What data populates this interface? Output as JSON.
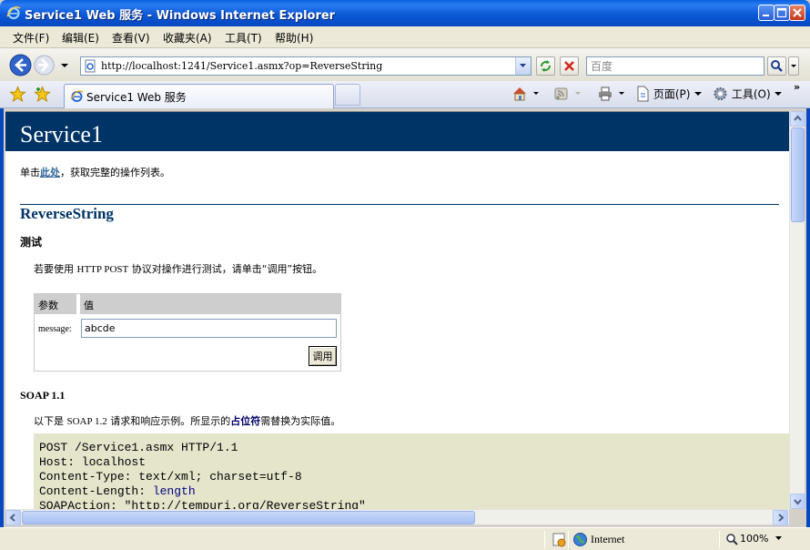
{
  "window": {
    "title": "Service1 Web 服务 - Windows Internet Explorer"
  },
  "menu": [
    "文件(F)",
    "编辑(E)",
    "查看(V)",
    "收藏夹(A)",
    "工具(T)",
    "帮助(H)"
  ],
  "address": {
    "url": "http://localhost:1241/Service1.asmx?op=ReverseString"
  },
  "search": {
    "placeholder": "百度"
  },
  "tab": {
    "label": "Service1 Web 服务"
  },
  "commands": {
    "page": "页面(P)",
    "tools": "工具(O)",
    "more": "»"
  },
  "page": {
    "title": "Service1",
    "intro_prefix": "单击",
    "intro_link": "此处",
    "intro_suffix": "，获取完整的操作列表。",
    "operation": "ReverseString",
    "test_heading": "测试",
    "test_desc_1": "若要使用 ",
    "test_desc_mono": "HTTP POST",
    "test_desc_2": " 协议对操作进行测试，请单击“调用”按钮。",
    "param_col": "参数",
    "value_col": "值",
    "param_name": "message:",
    "param_value": "abcde",
    "invoke": "调用",
    "soap_heading": "SOAP 1.1",
    "soap_desc_1": "以下是 ",
    "soap_desc_mono": "SOAP 1.2",
    "soap_desc_2": " 请求和响应示例。所显示的",
    "soap_desc_bold": "占位符",
    "soap_desc_3": "需替换为实际值。",
    "code": {
      "line1": "POST /Service1.asmx HTTP/1.1",
      "line2": "Host: localhost",
      "line3": "Content-Type: text/xml; charset=utf-8",
      "line4_prefix": "Content-Length: ",
      "line4_placeholder": "length",
      "line5": "SOAPAction: \"http://tempuri.org/ReverseString\""
    }
  },
  "status": {
    "zone": "Internet",
    "zoom": "100%"
  },
  "colors": {
    "title_bar": "#0c59d6",
    "page_header": "#003366",
    "code_bg": "#e5e5cc"
  },
  "icons": [
    "ie-icon",
    "minimize-icon",
    "maximize-icon",
    "close-icon",
    "back-icon",
    "forward-icon",
    "refresh-icon",
    "stop-icon",
    "search-icon",
    "favorites-star-icon",
    "add-favorites-icon",
    "home-icon",
    "feeds-icon",
    "print-icon",
    "page-icon",
    "gear-icon",
    "globe-icon",
    "zoom-icon"
  ]
}
